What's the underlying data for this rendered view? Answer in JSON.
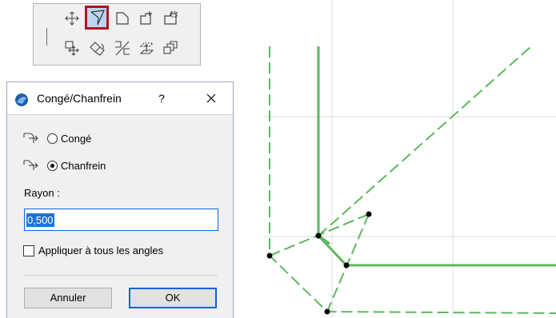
{
  "toolbar": {
    "icons": [
      "move-icon",
      "fillet-chamfer-icon",
      "edge-offset-icon",
      "add-corner-icon",
      "subtract-icon",
      "move-copy-icon",
      "rotate-icon",
      "split-icon",
      "elevate-icon",
      "multiply-icon"
    ],
    "active_tool": "fillet-chamfer-icon",
    "highlight_color": "#b0151c"
  },
  "dialog": {
    "title": "Congé/Chanfrein",
    "help_label": "?",
    "options": [
      {
        "label": "Congé",
        "selected": false
      },
      {
        "label": "Chanfrein",
        "selected": true
      }
    ],
    "radius_label": "Rayon :",
    "radius_value": "0,500",
    "apply_all_label": "Appliquer à tous les angles",
    "apply_all_checked": false,
    "cancel_label": "Annuler",
    "ok_label": "OK"
  },
  "canvas": {
    "line_color": "#5cb85c",
    "grid_color": "#dcdcdc"
  }
}
